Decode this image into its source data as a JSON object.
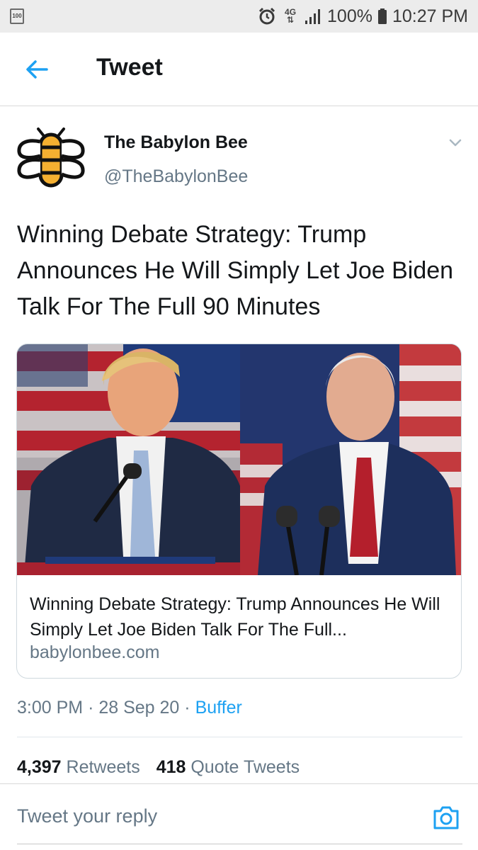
{
  "status_bar": {
    "notification_badge": "100",
    "network_type": "4G",
    "battery_percent": "100%",
    "time": "10:27 PM"
  },
  "header": {
    "title": "Tweet"
  },
  "tweet": {
    "author_name": "The Babylon Bee",
    "author_handle": "@TheBabylonBee",
    "text": "Winning Debate Strategy: Trump Announces He Will Simply Let Joe Biden Talk For The Full 90 Minutes",
    "card": {
      "title": "Winning Debate Strategy: Trump Announces He Will Simply Let Joe Biden Talk For The Full...",
      "domain": "babylonbee.com"
    },
    "time": "3:00 PM",
    "date": "28 Sep 20",
    "source": "Buffer",
    "separator": "·",
    "retweets_count": "4,397",
    "retweets_label": "Retweets",
    "quote_tweets_count": "418",
    "quote_tweets_label": "Quote Tweets"
  },
  "reply": {
    "placeholder": "Tweet your reply"
  },
  "colors": {
    "accent": "#1da1f2",
    "secondary_text": "#657786",
    "primary_text": "#14171a",
    "bee_yellow": "#f5b031"
  },
  "icons": {
    "back": "arrow-left-icon",
    "caret": "chevron-down-icon",
    "camera": "camera-icon",
    "alarm": "alarm-icon",
    "signal": "signal-icon",
    "battery": "battery-icon"
  }
}
